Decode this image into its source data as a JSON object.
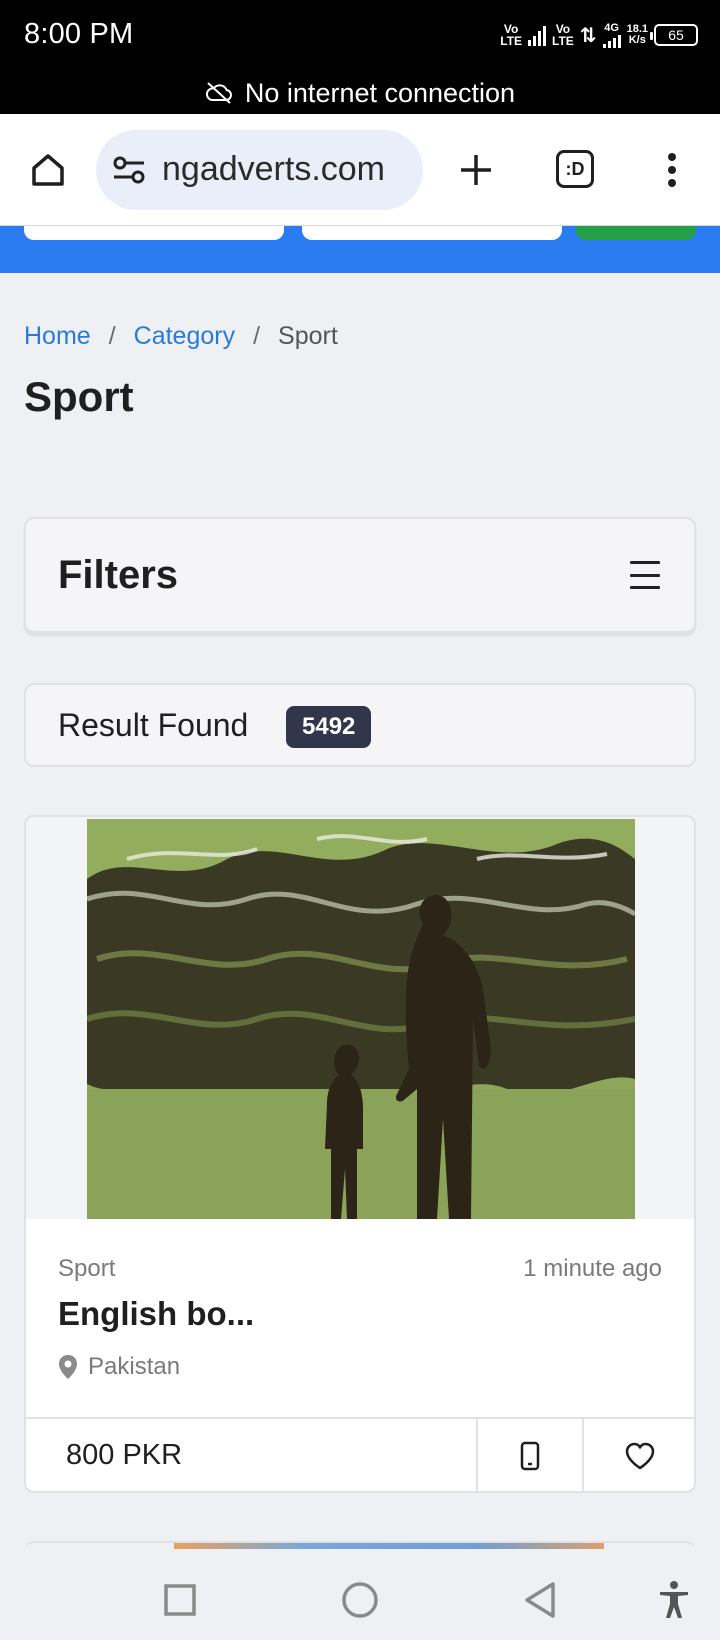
{
  "status_bar": {
    "time": "8:00 PM",
    "net1_top": "Vo",
    "net1_bottom": "LTE",
    "net2_top": "Vo",
    "net2_bottom": "LTE",
    "net3_label": "4G",
    "speed_top": "18.1",
    "speed_bottom": "K/s",
    "battery": "65"
  },
  "offline_banner": {
    "text": "No internet connection",
    "icon": "cloud-off-icon"
  },
  "browser": {
    "url": "ngadverts.com",
    "home_icon": "home-icon",
    "site_info_icon": "tune-icon",
    "new_tab_icon": "plus-icon",
    "tabs_label": ":D",
    "menu_icon": "more-vertical-icon"
  },
  "breadcrumb": {
    "home": "Home",
    "sep1": "/",
    "category": "Category",
    "sep2": "/",
    "current": "Sport"
  },
  "page": {
    "title": "Sport"
  },
  "filters": {
    "title": "Filters",
    "icon": "hamburger-menu-icon"
  },
  "results": {
    "label": "Result Found",
    "count": "5492"
  },
  "listing": {
    "category": "Sport",
    "time": "1 minute ago",
    "title": "English bo...",
    "location": "Pakistan",
    "price": "800 PKR",
    "image_description_icon": "book-cover-image",
    "phone_icon": "phone-icon",
    "favorite_icon": "heart-icon"
  },
  "colors": {
    "link": "#2a7bd9",
    "nav_strip": "#2b7cf0",
    "search_button": "#24a148",
    "badge": "#32364a"
  },
  "nav_bar": {
    "recents_icon": "square-icon",
    "home_icon": "circle-icon",
    "back_icon": "triangle-back-icon",
    "accessibility_icon": "accessibility-icon"
  }
}
